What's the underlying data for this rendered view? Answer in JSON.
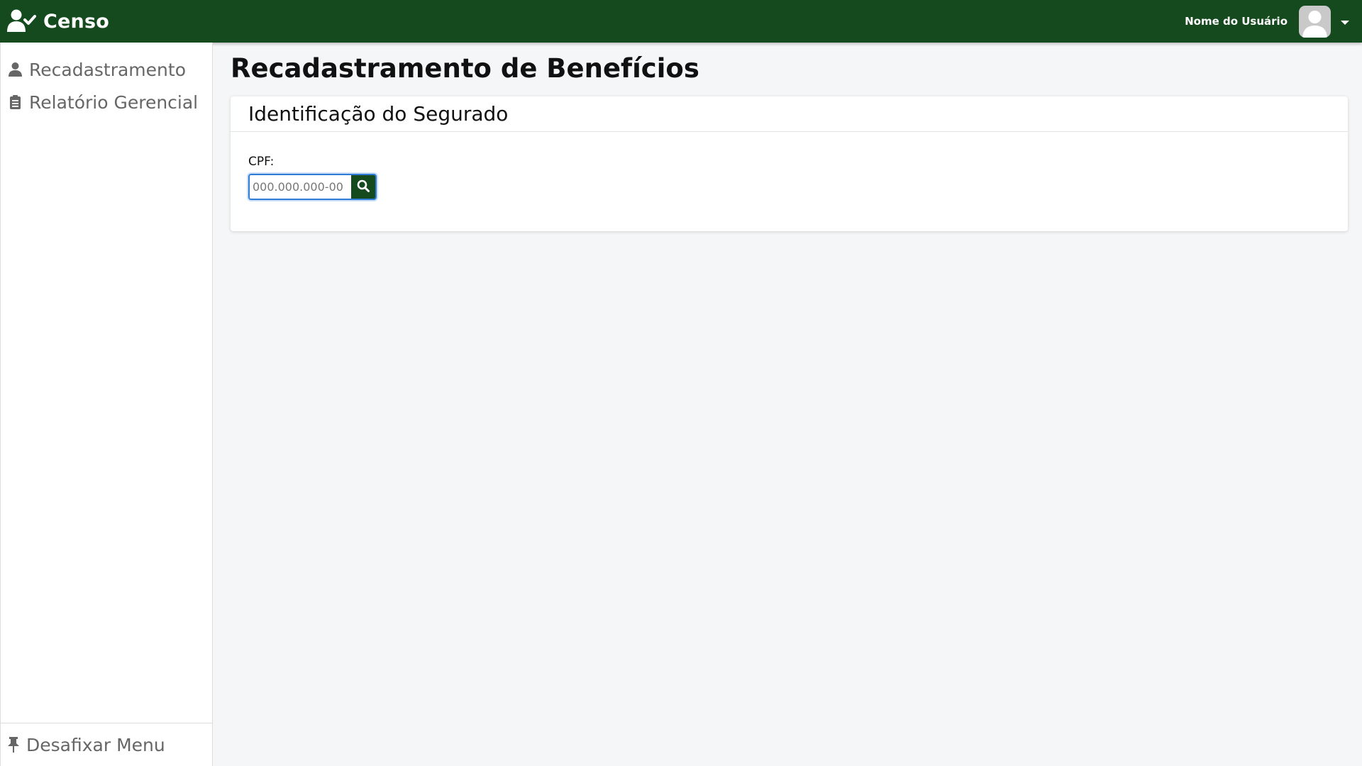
{
  "app": {
    "title": "Censo"
  },
  "header": {
    "user_name": "Nome do Usuário"
  },
  "sidebar": {
    "items": [
      {
        "label": "Recadastramento",
        "icon": "user-icon"
      },
      {
        "label": "Relatório Gerencial",
        "icon": "clipboard-icon"
      }
    ],
    "footer": {
      "label": "Desafixar Menu",
      "icon": "pin-icon"
    }
  },
  "main": {
    "page_title": "Recadastramento de Benefícios",
    "card": {
      "title": "Identificação do Segurado",
      "cpf_label": "CPF:",
      "cpf_value": "",
      "cpf_placeholder": "000.000.000-00"
    }
  },
  "colors": {
    "primary": "#144a1e",
    "focus": "#2d7bd6",
    "background": "#f5f6f8",
    "muted_text": "#666666"
  }
}
